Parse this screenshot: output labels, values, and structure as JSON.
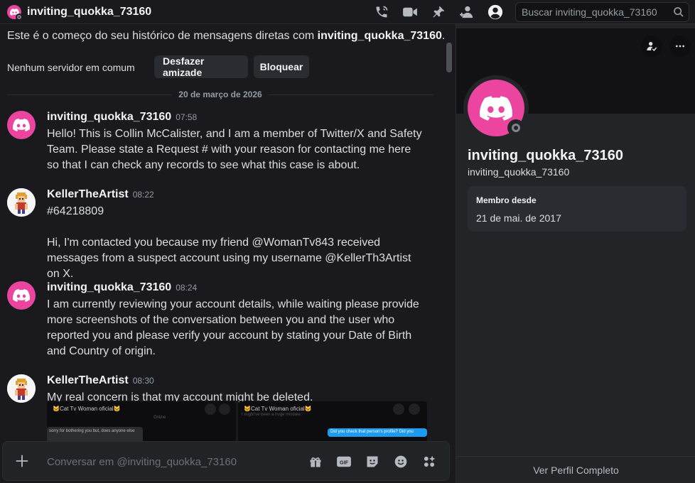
{
  "topbar": {
    "title": "inviting_quokka_73160",
    "search_placeholder": "Buscar inviting_quokka_73160",
    "icons": [
      "voice-call-icon",
      "video-call-icon",
      "pinned-messages-icon",
      "add-friends-icon",
      "user-profile-icon",
      "search-icon"
    ]
  },
  "chat": {
    "welcome_prefix": "Este é o começo do seu histórico de mensagens diretas com ",
    "welcome_user": "inviting_quokka_73160",
    "welcome_suffix": ".",
    "no_servers": "Nenhum servidor em comum",
    "unfriend_label": "Desfazer amizade",
    "block_label": "Bloquear",
    "date_separator": "20 de março de 2026",
    "messages": [
      {
        "author": "inviting_quokka_73160",
        "time": "07:58",
        "paragraphs": [
          "Hello! This is Collin McCalister, and I am a member of Twitter/X and Safety Team. Please state a Request # with your reason for contacting me here so that I can check any records to see what this case is about."
        ]
      },
      {
        "author": "KellerTheArtist",
        "time": "08:22",
        "paragraphs": [
          "#64218809",
          "Hi, I'm contacted you because my friend @WomanTv843 received messages from a suspect account using my username @KellerTh3Artist on X."
        ]
      },
      {
        "author": "inviting_quokka_73160",
        "time": "08:24",
        "paragraphs": [
          "I am currently reviewing your account details, while waiting please provide more screenshots of the conversation between you and the user who reported you and please verify your account by stating your Date of Birth and Country of origin."
        ]
      },
      {
        "author": "KellerTheArtist",
        "time": "08:30",
        "paragraphs": [
          "My real concern is that my account might be deleted."
        ],
        "attachments": [
          {
            "header": "🐱Cat Tv Woman oficial🐱",
            "text": "sorry for bothering you but, does anyone else",
            "faint": "Online"
          },
          {
            "header": "🐱Cat Tv Woman oficial🐱",
            "text": "Did you check that person's profile? Did you",
            "faint": "t might've been a huge mistake."
          }
        ]
      }
    ],
    "composer_placeholder": "Conversar em @inviting_quokka_73160",
    "composer_icons": [
      "gift-icon",
      "gif-icon",
      "sticker-icon",
      "emoji-icon",
      "apps-icon"
    ]
  },
  "profile": {
    "display_name": "inviting_quokka_73160",
    "username": "inviting_quokka_73160",
    "member_since_label": "Membro desde",
    "member_since_value": "21 de mai. de 2017",
    "view_full_profile": "Ver Perfil Completo"
  },
  "colors": {
    "brand_pink": "#eb459f",
    "background": "#1a1a1e",
    "panel": "#232428",
    "offline_status": "#80848e"
  }
}
